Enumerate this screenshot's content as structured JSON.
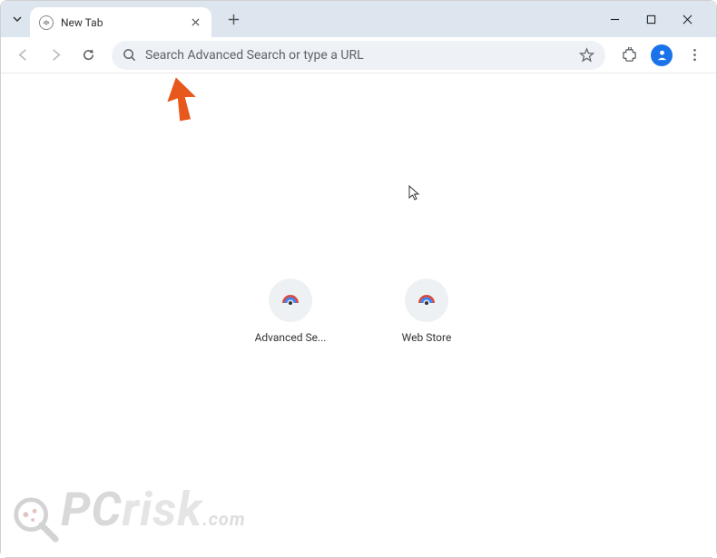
{
  "tab": {
    "title": "New Tab"
  },
  "omnibox": {
    "placeholder": "Search Advanced Search or type a URL"
  },
  "shortcuts": [
    {
      "label": "Advanced Se..."
    },
    {
      "label": "Web Store"
    }
  ],
  "watermark": {
    "pc": "PC",
    "risk": "risk",
    "com": ".com"
  }
}
